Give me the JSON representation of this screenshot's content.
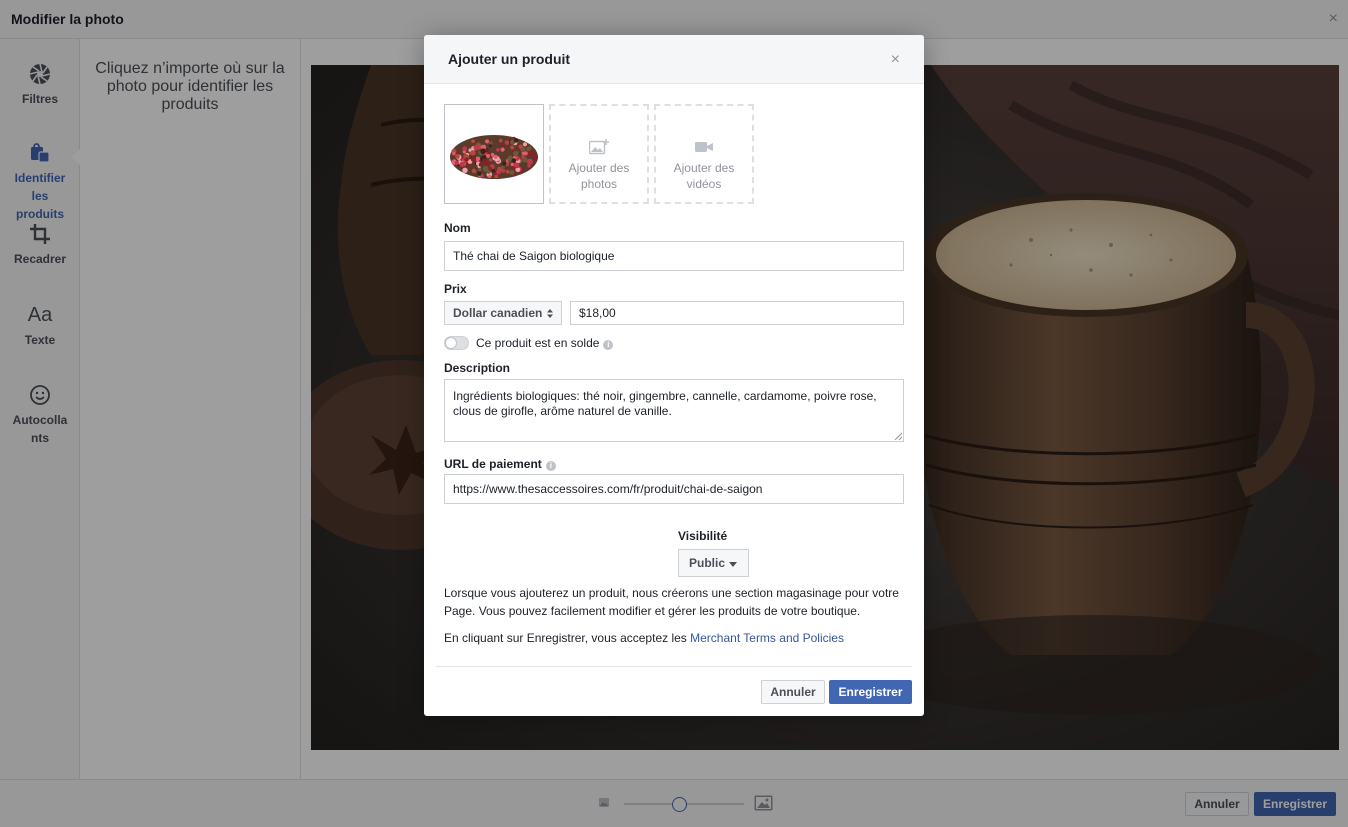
{
  "editor": {
    "title": "Modifier la photo",
    "close": "×",
    "tools": [
      {
        "label": "Filtres",
        "icon": "aperture-icon",
        "active": false
      },
      {
        "label": "Identifier les produits",
        "icon": "shopping-bag-icon",
        "active": true
      },
      {
        "label": "Recadrer",
        "icon": "crop-icon",
        "active": false
      },
      {
        "label": "Texte",
        "icon": "text-aa-icon",
        "glyph": "Aa",
        "active": false
      },
      {
        "label": "Autocolla nts",
        "icon": "smiley-icon",
        "active": false
      }
    ],
    "instructions": "Cliquez n’importe où sur la photo pour identifier les produits",
    "footer": {
      "zoom_level": 0.46,
      "cancel_label": "Annuler",
      "save_label": "Enregistrer"
    }
  },
  "modal": {
    "title": "Ajouter un produit",
    "close": "×",
    "media": {
      "add_photos_label": "Ajouter des photos",
      "add_videos_label": "Ajouter des vidéos"
    },
    "name": {
      "label": "Nom",
      "value": "Thé chai de Saigon biologique"
    },
    "price": {
      "label": "Prix",
      "currency": "Dollar canadien",
      "value": "$18,00"
    },
    "sale_toggle": {
      "label": "Ce produit est en solde",
      "on": false
    },
    "description": {
      "label": "Description",
      "value": "Ingrédients biologiques: thé noir, gingembre, cannelle, cardamome, poivre rose, clous de girofle, arôme naturel de vanille."
    },
    "payment_url": {
      "label": "URL de paiement",
      "value": "https://www.thesaccessoires.com/fr/produit/chai-de-saigon"
    },
    "visibility": {
      "label": "Visibilité",
      "value": "Public"
    },
    "notice": "Lorsque vous ajouterez un produit, nous créerons une section magasinage pour votre Page. Vous pouvez facilement modifier et gérer les produits de votre boutique.",
    "terms_prefix": "En cliquant sur Enregistrer, vous acceptez les ",
    "terms_link": "Merchant Terms and Policies",
    "cancel_label": "Annuler",
    "save_label": "Enregistrer"
  },
  "colors": {
    "accent": "#4267b2",
    "link": "#365899",
    "panel_bg": "#f5f6f7",
    "border": "#dddfe2"
  }
}
